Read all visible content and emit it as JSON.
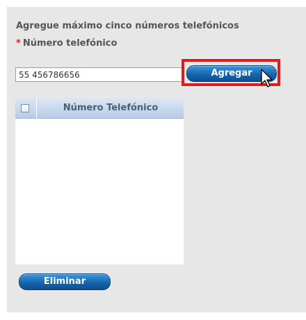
{
  "form": {
    "instructions": "Agregue máximo cinco números telefónicos",
    "required_marker": "*",
    "phone_label": "Número telefónico",
    "phone_value": "55 456786656"
  },
  "buttons": {
    "add_label": "Agregar",
    "delete_label": "Eliminar"
  },
  "table": {
    "column_header": "Número Telefónico",
    "rows": []
  },
  "colors": {
    "panel_bg": "#e7e7e7",
    "button_blue": "#1565ad",
    "required_red": "#d7262c",
    "highlight_red": "#e01b1b"
  },
  "icons": {
    "pointer": "mouse-pointer-icon"
  }
}
